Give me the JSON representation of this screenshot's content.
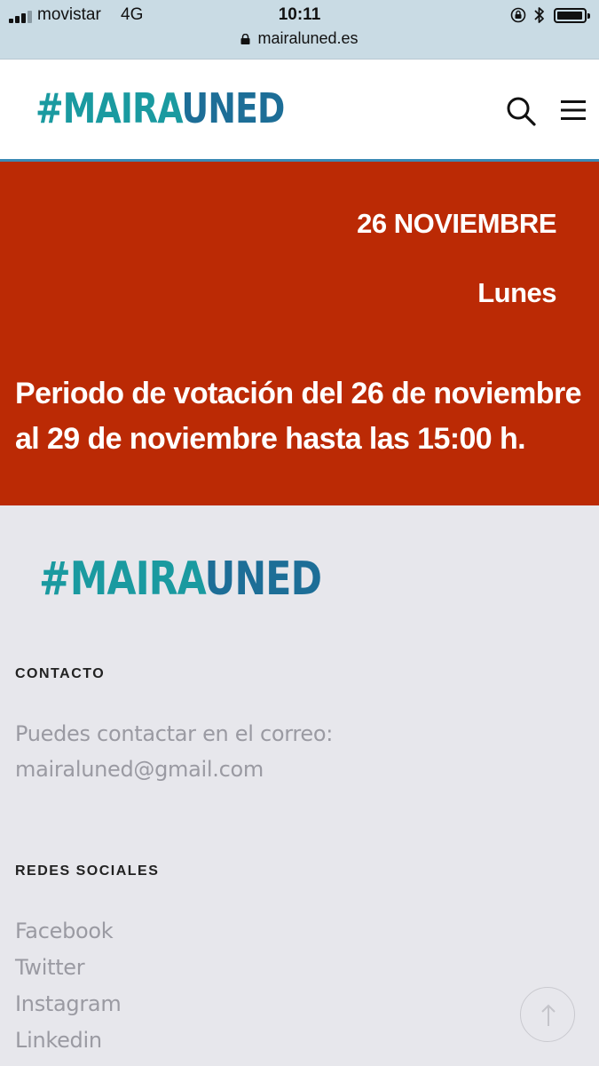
{
  "status_bar": {
    "carrier": "movistar",
    "network": "4G",
    "time": "10:11",
    "url": "mairaluned.es"
  },
  "header": {
    "logo_hash": "#",
    "logo_main": "MAIRA",
    "logo_accent": "UNED"
  },
  "banner": {
    "date": "26 NOVIEMBRE",
    "day": "Lunes",
    "description": "Periodo de votación del 26 de noviembre al 29 de noviembre hasta las 15:00 h.",
    "background_color": "#bb2a05"
  },
  "footer": {
    "logo_hash": "#",
    "logo_main": "MAIRA",
    "logo_accent": "UNED",
    "contact": {
      "title": "CONTACTO",
      "line1": "Puedes contactar en el correo:",
      "line2": "mairaluned@gmail.com"
    },
    "social": {
      "title": "REDES SOCIALES",
      "items": [
        "Facebook",
        "Twitter",
        "Instagram",
        "Linkedin"
      ]
    }
  },
  "colors": {
    "logo_teal": "#1a9aa0",
    "logo_blue": "#1d6e97",
    "footer_bg": "#e7e7ec"
  }
}
